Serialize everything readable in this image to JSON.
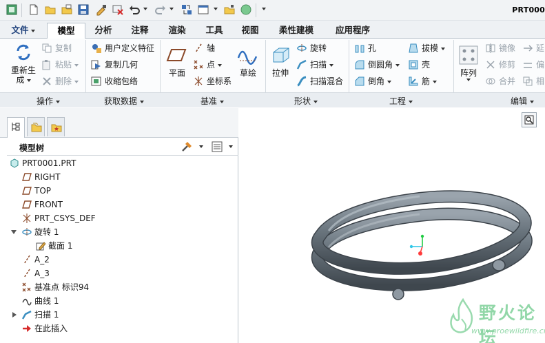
{
  "window": {
    "title": "PRT000"
  },
  "colors": {
    "accent": "#1c3f7a",
    "model_gray": "#6e7a84",
    "watermark": "#7fd19a",
    "axis_x": "#ff3b3b",
    "axis_y": "#22cc44",
    "axis_z": "#33c8e8"
  },
  "tabs": [
    {
      "label": "文件"
    },
    {
      "label": "模型"
    },
    {
      "label": "分析"
    },
    {
      "label": "注释"
    },
    {
      "label": "渲染"
    },
    {
      "label": "工具"
    },
    {
      "label": "视图"
    },
    {
      "label": "柔性建模"
    },
    {
      "label": "应用程序"
    }
  ],
  "ribbon": {
    "groups": [
      {
        "label": "操作"
      },
      {
        "label": "获取数据"
      },
      {
        "label": "基准"
      },
      {
        "label": "形状"
      },
      {
        "label": "工程"
      },
      {
        "label": "编辑"
      }
    ],
    "operations": {
      "regenerate_line1": "重新生",
      "regenerate_line2": "成",
      "copy": "复制",
      "paste": "粘贴",
      "delete": "删除"
    },
    "get_data": {
      "udf": "用户定义特征",
      "copy_geom": "复制几何",
      "shrinkwrap": "收缩包络"
    },
    "datum": {
      "plane": "平面",
      "axis": "轴",
      "point": "点",
      "csys": "坐标系",
      "sketch": "草绘"
    },
    "shapes": {
      "extrude": "拉伸",
      "revolve": "旋转",
      "sweep": "扫描",
      "swept_blend": "扫描混合"
    },
    "engineering": {
      "hole": "孔",
      "round": "倒圆角",
      "chamfer": "倒角",
      "draft": "拔模",
      "shell": "壳",
      "rib": "筋"
    },
    "editing": {
      "pattern": "阵列",
      "mirror": "镜像",
      "trim": "修剪",
      "merge": "合并",
      "extend": "延",
      "offset": "偏",
      "intersect": "相"
    }
  },
  "panel": {
    "title": "模型树",
    "tree": [
      {
        "label": "PRT0001.PRT"
      },
      {
        "label": "RIGHT"
      },
      {
        "label": "TOP"
      },
      {
        "label": "FRONT"
      },
      {
        "label": "PRT_CSYS_DEF"
      },
      {
        "label": "旋转 1"
      },
      {
        "label": "截面 1"
      },
      {
        "label": "A_2"
      },
      {
        "label": "A_3"
      },
      {
        "label": "基准点 标识94"
      },
      {
        "label": "曲线 1"
      },
      {
        "label": "扫描 1"
      },
      {
        "label": "在此插入"
      }
    ]
  },
  "watermark": {
    "title": "野火论坛",
    "url": "www.proewildfire.cn"
  }
}
